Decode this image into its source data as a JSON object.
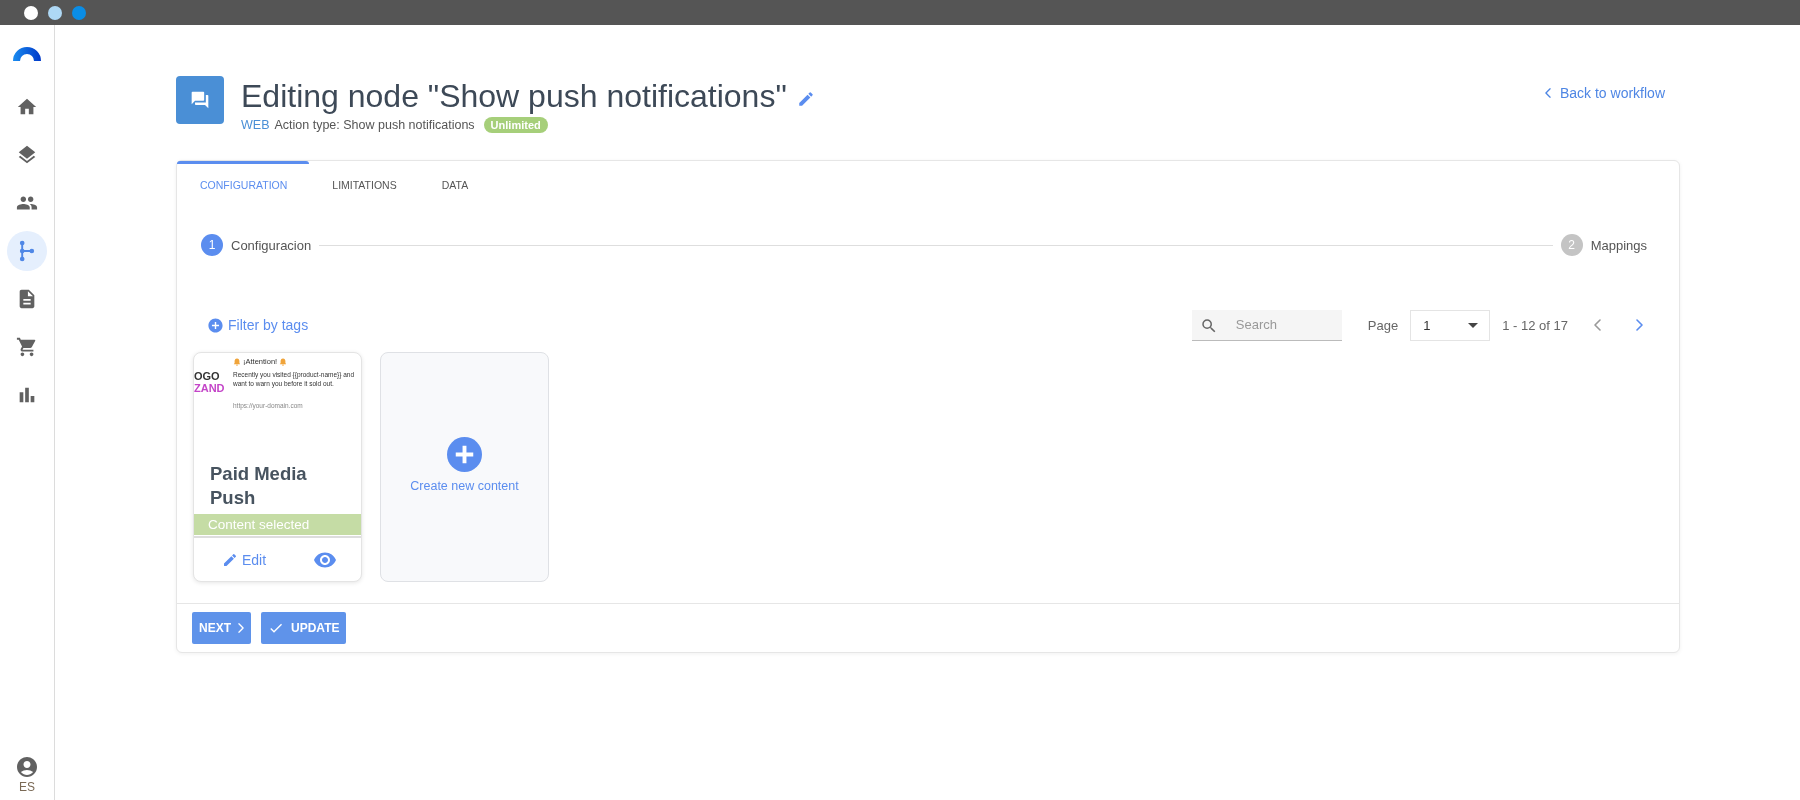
{
  "window": {
    "controls": [
      {
        "color": "#ffffff"
      },
      {
        "color": "#aed8f5"
      },
      {
        "color": "#0a8de6"
      }
    ]
  },
  "sidebar": {
    "items": [
      {
        "selected": false
      },
      {
        "selected": false
      },
      {
        "selected": false
      },
      {
        "selected": true
      },
      {
        "selected": false
      },
      {
        "selected": false
      },
      {
        "selected": false
      }
    ],
    "language": "ES"
  },
  "header": {
    "title": "Editing node \"Show push notifications\"",
    "channel": "WEB",
    "action_type": "Action type: Show push notifications",
    "badge": "Unlimited",
    "back_link": "Back to workflow"
  },
  "tabs": [
    {
      "label": "CONFIGURATION",
      "selected": true
    },
    {
      "label": "LIMITATIONS",
      "selected": false
    },
    {
      "label": "DATA",
      "selected": false
    }
  ],
  "stepper": [
    {
      "number": "1",
      "label": "Configuracion",
      "selected": true
    },
    {
      "number": "2",
      "label": "Mappings",
      "selected": false
    }
  ],
  "toolbar": {
    "filter": "Filter by tags",
    "search": {
      "placeholder": "Search"
    },
    "pagination": {
      "label": "Page",
      "page": "1",
      "range": "1 - 12 of 17",
      "prev_disabled": true,
      "next_disabled": false
    }
  },
  "contents": [
    {
      "kind": "content",
      "selected": true,
      "preview": {
        "logo_lines": [
          "OGO",
          "ZAND"
        ],
        "heading": "¡Attention!",
        "body": "Recently you visited {{product-name}} and want to warn you before it sold out.",
        "url": "https://your-domain.com"
      },
      "title": "Paid Media Push",
      "status": "Content selected",
      "edit": "Edit"
    },
    {
      "kind": "create",
      "label": "Create new content"
    }
  ],
  "footer": {
    "buttons": [
      {
        "kind": "next",
        "label": "NEXT"
      },
      {
        "kind": "update",
        "label": "UPDATE"
      }
    ]
  }
}
